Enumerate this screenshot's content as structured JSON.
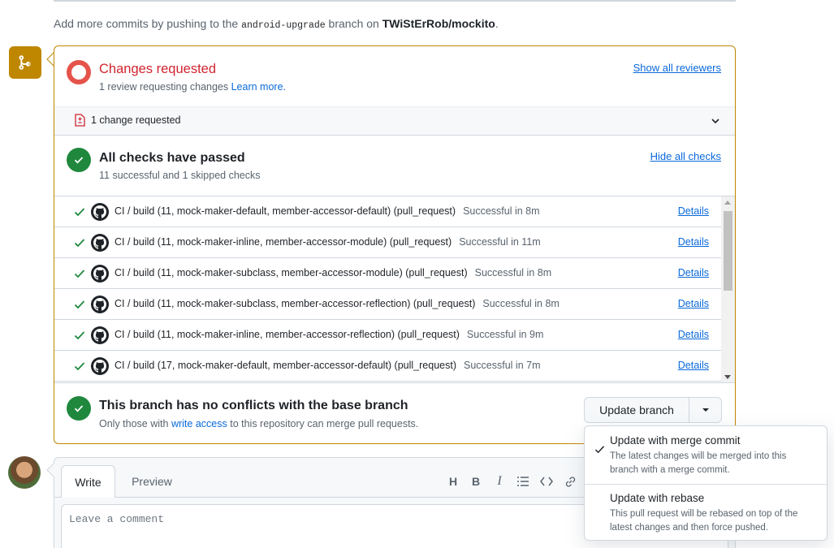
{
  "push_note": {
    "prefix": "Add more commits by pushing to the",
    "branch": "android-upgrade",
    "middle": "branch on",
    "repo": "TWiStErRob/mockito",
    "suffix": "."
  },
  "review": {
    "title": "Changes requested",
    "subtitle": "1 review requesting changes",
    "learn_more": "Learn more.",
    "show_reviewers": "Show all reviewers",
    "change_requested": "1 change requested"
  },
  "checks": {
    "title": "All checks have passed",
    "subtitle": "11 successful and 1 skipped checks",
    "hide_link": "Hide all checks",
    "details_label": "Details",
    "rows": [
      {
        "name": "CI / build (11, mock-maker-default, member-accessor-default) (pull_request)",
        "duration": "Successful in 8m"
      },
      {
        "name": "CI / build (11, mock-maker-inline, member-accessor-module) (pull_request)",
        "duration": "Successful in 11m"
      },
      {
        "name": "CI / build (11, mock-maker-subclass, member-accessor-module) (pull_request)",
        "duration": "Successful in 8m"
      },
      {
        "name": "CI / build (11, mock-maker-subclass, member-accessor-reflection) (pull_request)",
        "duration": "Successful in 8m"
      },
      {
        "name": "CI / build (11, mock-maker-inline, member-accessor-reflection) (pull_request)",
        "duration": "Successful in 9m"
      },
      {
        "name": "CI / build (17, mock-maker-default, member-accessor-default) (pull_request)",
        "duration": "Successful in 7m"
      }
    ]
  },
  "branch": {
    "title": "This branch has no conflicts with the base branch",
    "subtitle_prefix": "Only those with",
    "write_access": "write access",
    "subtitle_suffix": "to this repository can merge pull requests.",
    "update_button": "Update branch"
  },
  "dropdown": {
    "items": [
      {
        "title": "Update with merge commit",
        "desc": "The latest changes will be merged into this branch with a merge commit.",
        "selected": true
      },
      {
        "title": "Update with rebase",
        "desc": "This pull request will be rebased on top of the latest changes and then force pushed.",
        "selected": false
      }
    ]
  },
  "comment": {
    "tab_write": "Write",
    "tab_preview": "Preview",
    "placeholder": "Leave a comment",
    "toolbar_icons": [
      "heading-icon",
      "bold-icon",
      "italic-icon",
      "list-icon",
      "code-icon",
      "link-icon"
    ]
  },
  "colors": {
    "warning": "#bf8700",
    "danger": "#d1242f",
    "success": "#1f883d",
    "link": "#0969da"
  }
}
